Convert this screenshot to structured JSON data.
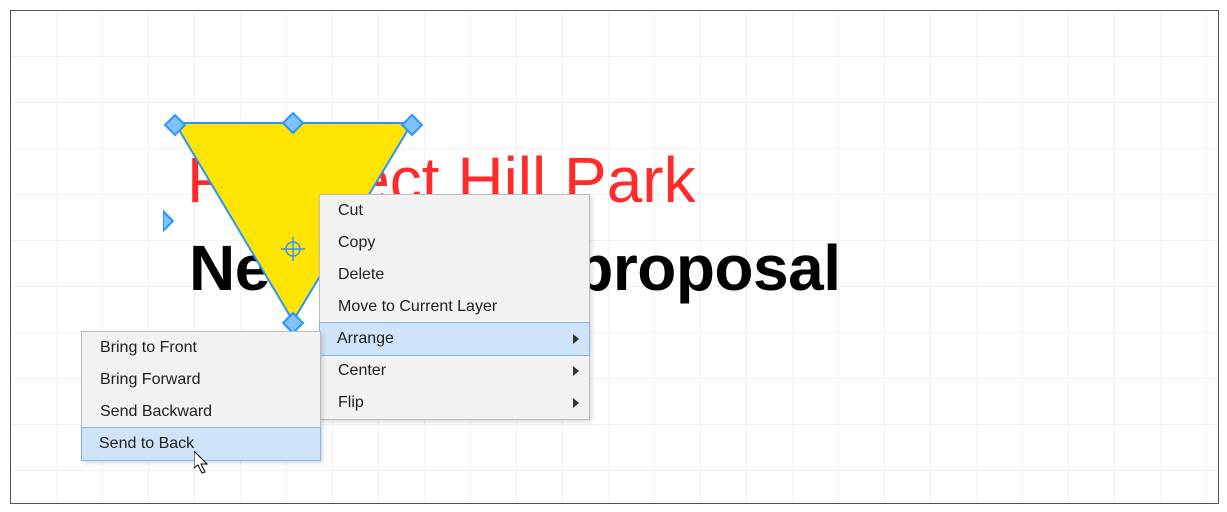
{
  "canvas": {
    "title_line1": "Prospect Hill Park",
    "title_line2": "New seating proposal"
  },
  "shape": {
    "type": "triangle",
    "fill": "#ffe400",
    "stroke": "#2a95ff"
  },
  "menu_main": {
    "items": [
      {
        "label": "Cut",
        "submenu": false,
        "hl": false
      },
      {
        "label": "Copy",
        "submenu": false,
        "hl": false
      },
      {
        "label": "Delete",
        "submenu": false,
        "hl": false
      },
      {
        "label": "Move to Current Layer",
        "submenu": false,
        "hl": false
      },
      {
        "label": "Arrange",
        "submenu": true,
        "hl": true
      },
      {
        "label": "Center",
        "submenu": true,
        "hl": false
      },
      {
        "label": "Flip",
        "submenu": true,
        "hl": false
      }
    ]
  },
  "menu_sub": {
    "items": [
      {
        "label": "Bring to Front",
        "hl": false
      },
      {
        "label": "Bring Forward",
        "hl": false
      },
      {
        "label": "Send Backward",
        "hl": false
      },
      {
        "label": "Send to Back",
        "hl": true
      }
    ]
  }
}
